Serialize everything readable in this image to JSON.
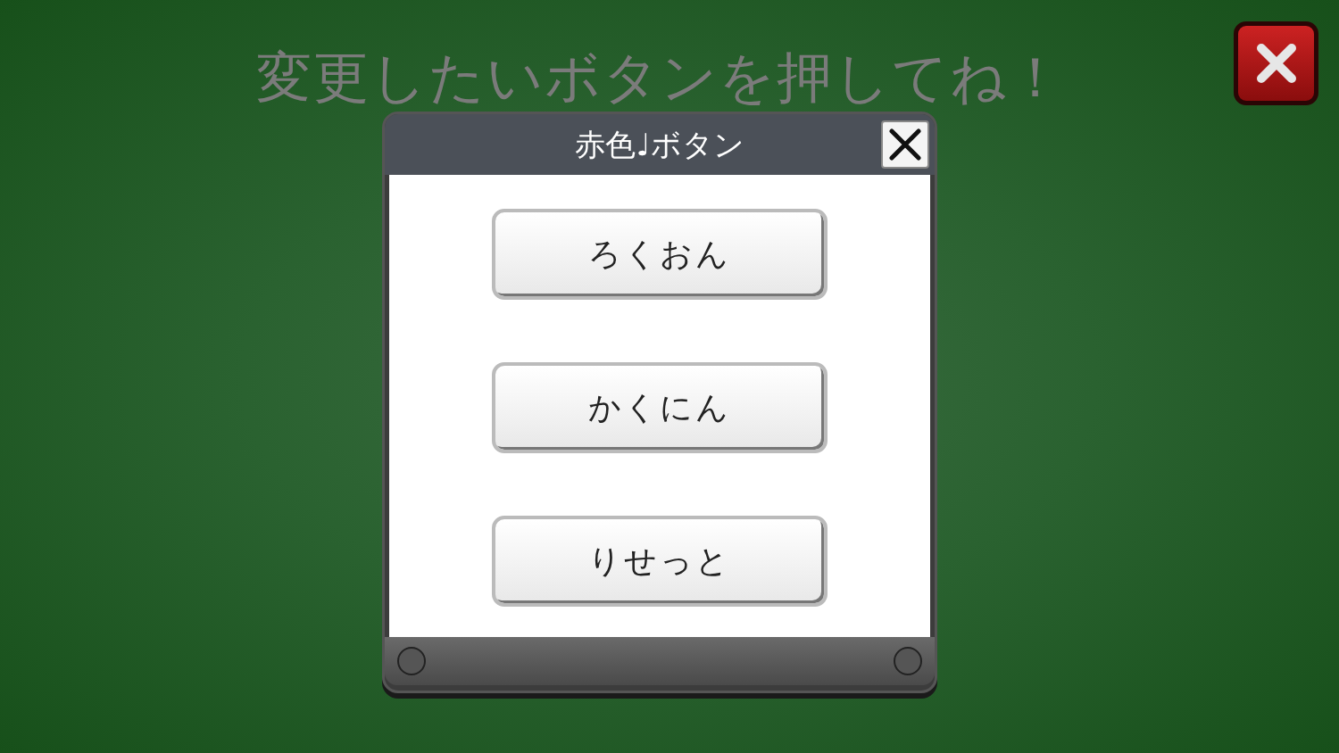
{
  "title": "変更したいボタンを押してね！",
  "dialog": {
    "title": "赤色♩ボタン",
    "buttons": [
      {
        "label": "ろくおん"
      },
      {
        "label": "かくにん"
      },
      {
        "label": "りせっと"
      }
    ]
  }
}
